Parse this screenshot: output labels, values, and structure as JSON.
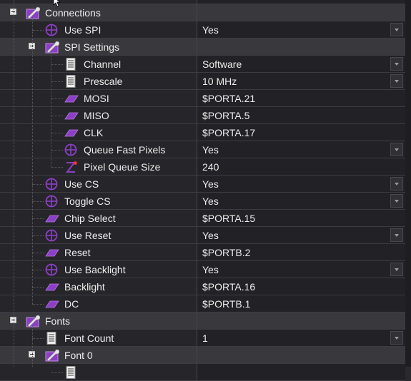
{
  "colors": {
    "accent_purple": "#8b3fc6",
    "value_text": "#ececec",
    "category_bg": "#38383d"
  },
  "icons": {
    "category": "wrench-folder-icon",
    "bool": "circle-crosshair-icon",
    "list": "document-list-icon",
    "pin": "pin-parallelogram-icon",
    "number": "z-number-icon"
  },
  "rows": [
    {
      "label": "Connections",
      "kind": "cat",
      "level": 0,
      "icon": "category",
      "value": "",
      "dropdown": false
    },
    {
      "label": "Use SPI",
      "kind": "prop",
      "level": 1,
      "icon": "bool",
      "value": "Yes",
      "dropdown": true
    },
    {
      "label": "SPI Settings",
      "kind": "cat",
      "level": 1,
      "icon": "category",
      "value": "",
      "dropdown": false
    },
    {
      "label": "Channel",
      "kind": "prop",
      "level": 2,
      "icon": "list",
      "value": "Software",
      "dropdown": true
    },
    {
      "label": "Prescale",
      "kind": "prop",
      "level": 2,
      "icon": "list",
      "value": "10 MHz",
      "dropdown": true
    },
    {
      "label": "MOSI",
      "kind": "prop",
      "level": 2,
      "icon": "pin",
      "value": "$PORTA.21",
      "dropdown": false
    },
    {
      "label": "MISO",
      "kind": "prop",
      "level": 2,
      "icon": "pin",
      "value": "$PORTA.5",
      "dropdown": false
    },
    {
      "label": "CLK",
      "kind": "prop",
      "level": 2,
      "icon": "pin",
      "value": "$PORTA.17",
      "dropdown": false
    },
    {
      "label": "Queue Fast Pixels",
      "kind": "prop",
      "level": 2,
      "icon": "bool",
      "value": "Yes",
      "dropdown": true
    },
    {
      "label": "Pixel Queue Size",
      "kind": "prop",
      "level": 2,
      "icon": "number",
      "value": "240",
      "dropdown": false
    },
    {
      "label": "Use CS",
      "kind": "prop",
      "level": 1,
      "icon": "bool",
      "value": "Yes",
      "dropdown": true
    },
    {
      "label": "Toggle CS",
      "kind": "prop",
      "level": 1,
      "icon": "bool",
      "value": "Yes",
      "dropdown": true
    },
    {
      "label": "Chip Select",
      "kind": "prop",
      "level": 1,
      "icon": "pin",
      "value": "$PORTA.15",
      "dropdown": false
    },
    {
      "label": "Use Reset",
      "kind": "prop",
      "level": 1,
      "icon": "bool",
      "value": "Yes",
      "dropdown": true
    },
    {
      "label": "Reset",
      "kind": "prop",
      "level": 1,
      "icon": "pin",
      "value": "$PORTB.2",
      "dropdown": false
    },
    {
      "label": "Use Backlight",
      "kind": "prop",
      "level": 1,
      "icon": "bool",
      "value": "Yes",
      "dropdown": true
    },
    {
      "label": "Backlight",
      "kind": "prop",
      "level": 1,
      "icon": "pin",
      "value": "$PORTA.16",
      "dropdown": false
    },
    {
      "label": "DC",
      "kind": "prop",
      "level": 1,
      "icon": "pin",
      "value": "$PORTB.1",
      "dropdown": false
    },
    {
      "label": "Fonts",
      "kind": "cat",
      "level": 0,
      "icon": "category",
      "value": "",
      "dropdown": false
    },
    {
      "label": "Font Count",
      "kind": "prop",
      "level": 1,
      "icon": "list",
      "value": "1",
      "dropdown": true
    },
    {
      "label": "Font 0",
      "kind": "cat",
      "level": 1,
      "icon": "category",
      "value": "",
      "dropdown": false
    }
  ]
}
